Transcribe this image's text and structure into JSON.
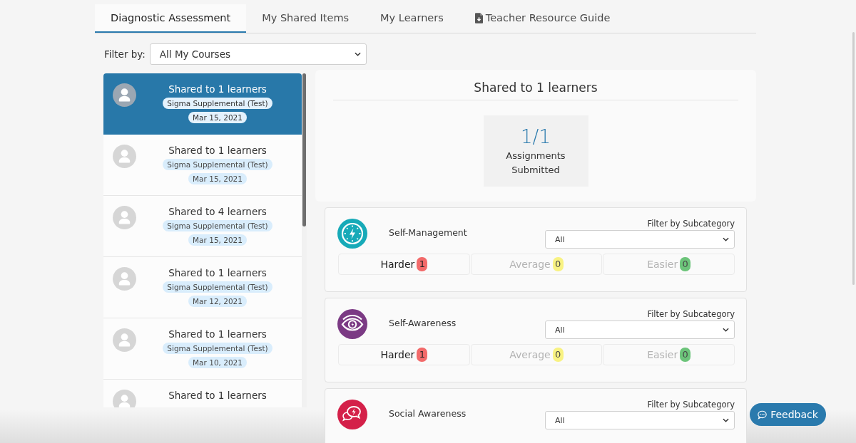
{
  "tabs": [
    {
      "label": "Diagnostic Assessment",
      "selected": true,
      "kind": "plain"
    },
    {
      "label": "My Shared Items",
      "selected": false,
      "kind": "plain"
    },
    {
      "label": "My Learners",
      "selected": false,
      "kind": "plain"
    },
    {
      "label": "Teacher Resource Guide",
      "selected": false,
      "kind": "document"
    }
  ],
  "filter": {
    "label": "Filter by:",
    "value": "All My Courses"
  },
  "shared_list": {
    "items": [
      {
        "title": "Shared to 1 learners",
        "course": "Sigma Supplemental (Test)",
        "date": "Mar 15, 2021",
        "selected": true
      },
      {
        "title": "Shared to 1 learners",
        "course": "Sigma Supplemental (Test)",
        "date": "Mar 15, 2021",
        "selected": false
      },
      {
        "title": "Shared to 4 learners",
        "course": "Sigma Supplemental (Test)",
        "date": "Mar 15, 2021",
        "selected": false
      },
      {
        "title": "Shared to 1 learners",
        "course": "Sigma Supplemental (Test)",
        "date": "Mar 12, 2021",
        "selected": false
      },
      {
        "title": "Shared to 1 learners",
        "course": "Sigma Supplemental (Test)",
        "date": "Mar 10, 2021",
        "selected": false
      },
      {
        "title": "Shared to 1 learners",
        "selected": false
      }
    ]
  },
  "summary": {
    "title": "Shared to 1 learners",
    "stat_value": "1/1",
    "stat_label": "Assignments Submitted"
  },
  "categories": [
    {
      "name": "Self-Management",
      "kind": "management",
      "color": "#17aab8",
      "filter_label": "Filter by Subcategory",
      "filter_value": "All",
      "ratings": [
        {
          "label": "Harder",
          "count": "1",
          "color": "#f26a6a",
          "disabled": false
        },
        {
          "label": "Average",
          "count": "0",
          "color": "#f8f282",
          "disabled": true
        },
        {
          "label": "Easier",
          "count": "0",
          "color": "#6cc47a",
          "disabled": true
        }
      ]
    },
    {
      "name": "Self-Awareness",
      "kind": "awareness",
      "color": "#7b3a84",
      "filter_label": "Filter by Subcategory",
      "filter_value": "All",
      "ratings": [
        {
          "label": "Harder",
          "count": "1",
          "color": "#f26a6a",
          "disabled": false
        },
        {
          "label": "Average",
          "count": "0",
          "color": "#f8f282",
          "disabled": true
        },
        {
          "label": "Easier",
          "count": "0",
          "color": "#6cc47a",
          "disabled": true
        }
      ]
    },
    {
      "name": "Social Awareness",
      "kind": "social",
      "color": "#d42049",
      "filter_label": "Filter by Subcategory",
      "filter_value": "All"
    }
  ],
  "feedback_button": {
    "label": "Feedback"
  }
}
